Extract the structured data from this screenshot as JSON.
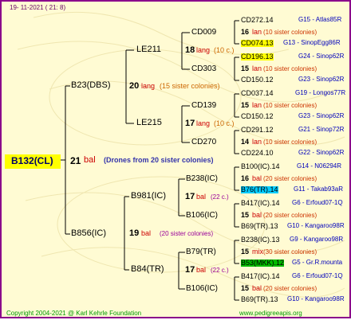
{
  "date": "19- 11-2021 ( 21: 8)",
  "footer": {
    "copyright": "Copyright 2004-2021 @ Karl Kehrle Foundation",
    "website": "www.pedigreeapis.org"
  },
  "colors": {
    "frame": "#8b008b",
    "background": "#fffbd3",
    "root_highlight": "#ffff00",
    "line": "#000000"
  },
  "root": {
    "name": "B132(CL)",
    "number": "21",
    "code": "bal",
    "note": "(Drones from 20 sister colonies)"
  },
  "mother": {
    "name": "B23(DBS)",
    "number": "20",
    "code": "lang",
    "sisters": "(15 sister colonies)",
    "mother": {
      "name": "LE211",
      "number": "18",
      "code": "lang",
      "sisters": "(10 c.)",
      "mother": {
        "name": "CD009",
        "leaves": [
          {
            "id": "CD272.14",
            "info": "G15 - Atlas85R"
          },
          {
            "num": "16",
            "code": "lan",
            "sisters": "(10 sister colonies)"
          },
          {
            "id": "CD074.13",
            "info": "G13 - SinopEgg86R"
          }
        ]
      },
      "father": {
        "name": "CD303",
        "leaves": [
          {
            "id": "CD196.13",
            "info": "G24 - Sinop62R"
          },
          {
            "num": "15",
            "code": "lan",
            "sisters": "(10 sister colonies)"
          },
          {
            "id": "CD150.12",
            "info": "G23 - Sinop62R"
          }
        ]
      }
    },
    "father": {
      "name": "LE215",
      "number": "17",
      "code": "lang",
      "sisters": "(10 c.)",
      "mother": {
        "name": "CD139",
        "leaves": [
          {
            "id": "CD037.14",
            "info": "G19 - Longos77R"
          },
          {
            "num": "15",
            "code": "lan",
            "sisters": "(10 sister colonies)"
          },
          {
            "id": "CD150.12",
            "info": "G23 - Sinop62R"
          }
        ]
      },
      "father": {
        "name": "CD270",
        "leaves": [
          {
            "id": "CD291.12",
            "info": "G21 - Sinop72R"
          },
          {
            "num": "14",
            "code": "lan",
            "sisters": "(10 sister colonies)"
          },
          {
            "id": "CD224.10",
            "info": "G22 - Sinop62R"
          }
        ]
      }
    }
  },
  "father": {
    "name": "B856(IC)",
    "number": "19",
    "code": "bal",
    "sisters": "(20 sister colonies)",
    "mother": {
      "name": "B981(IC)",
      "number": "17",
      "code": "bal",
      "sisters": "(22 c.)",
      "mother": {
        "name": "B238(IC)",
        "leaves": [
          {
            "id": "B100(IC).14",
            "info": "G14 - N06294R"
          },
          {
            "num": "16",
            "code": "bal",
            "sisters": "(20 sister colonies)"
          },
          {
            "id": "B76(TR).14",
            "info": "G11 - Takab93aR"
          }
        ]
      },
      "father": {
        "name": "B106(IC)",
        "leaves": [
          {
            "id": "B417(IC).14",
            "info": "G6 - Erfoud07-1Q"
          },
          {
            "num": "15",
            "code": "bal",
            "sisters": "(20 sister colonies)"
          },
          {
            "id": "B69(TR).13",
            "info": "G10 - Kangaroo98R"
          }
        ]
      }
    },
    "father": {
      "name": "B84(TR)",
      "number": "17",
      "code": "bal",
      "sisters": "(22 c.)",
      "mother": {
        "name": "B79(TR)",
        "leaves": [
          {
            "id": "B238(IC).13",
            "info": "G9 - Kangaroo98R"
          },
          {
            "num": "15",
            "code": "mix",
            "sisters": "(30 sister colonies)"
          },
          {
            "id": "B53(MKK).12",
            "info": "G5 - Gr.R.mounta"
          }
        ]
      },
      "father": {
        "name": "B106(IC)",
        "leaves": [
          {
            "id": "B417(IC).14",
            "info": "G6 - Erfoud07-1Q"
          },
          {
            "num": "15",
            "code": "bal",
            "sisters": "(20 sister colonies)"
          },
          {
            "id": "B69(TR).13",
            "info": "G10 - Kangaroo98R"
          }
        ]
      }
    }
  }
}
